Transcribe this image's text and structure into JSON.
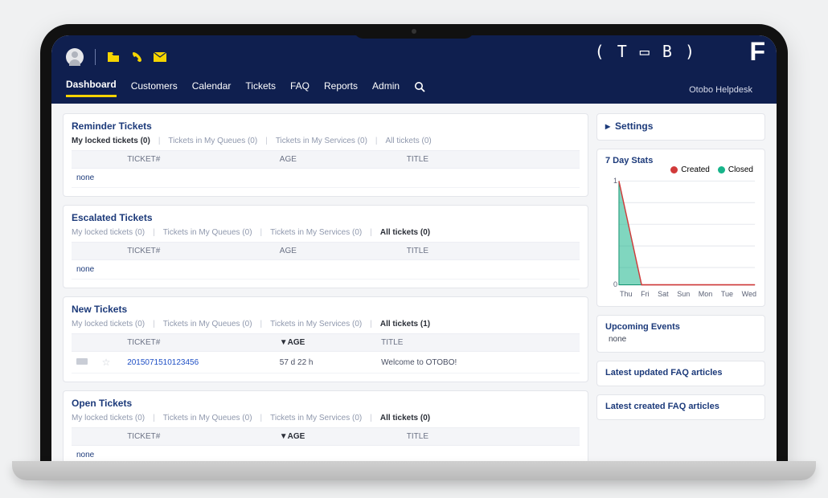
{
  "brand": {
    "logo_text": "( T ▭ B )",
    "f": "F",
    "name": "Otobo Helpdesk"
  },
  "nav": {
    "items": [
      "Dashboard",
      "Customers",
      "Calendar",
      "Tickets",
      "FAQ",
      "Reports",
      "Admin"
    ],
    "active": 0
  },
  "filters": {
    "my_locked_0": "My locked tickets (0)",
    "my_queues_0": "Tickets in My Queues (0)",
    "my_services_0": "Tickets in My Services (0)",
    "all_0": "All tickets (0)",
    "all_1": "All tickets (1)"
  },
  "cols": {
    "ticket": "TICKET#",
    "age": "AGE",
    "age_sorted": "▼AGE",
    "title": "TITLE"
  },
  "widgets": {
    "reminder": {
      "title": "Reminder Tickets",
      "empty": "none"
    },
    "escalated": {
      "title": "Escalated Tickets",
      "empty": "none"
    },
    "new": {
      "title": "New Tickets",
      "rows": [
        {
          "ticket": "2015071510123456",
          "age": "57 d 22 h",
          "title": "Welcome to OTOBO!"
        }
      ]
    },
    "open": {
      "title": "Open Tickets",
      "empty": "none"
    }
  },
  "sidebar": {
    "settings": "Settings",
    "stats_title": "7 Day Stats",
    "upcoming_title": "Upcoming Events",
    "upcoming_none": "none",
    "faq_updated": "Latest updated FAQ articles",
    "faq_created": "Latest created FAQ articles",
    "legend": {
      "created": "Created",
      "closed": "Closed"
    }
  },
  "chart_data": {
    "type": "area",
    "x": [
      "Thu",
      "Fri",
      "Sat",
      "Sun",
      "Mon",
      "Tue",
      "Wed"
    ],
    "series": [
      {
        "name": "Created",
        "color": "#d13a3a",
        "values": [
          1,
          0,
          0,
          0,
          0,
          0,
          0
        ]
      },
      {
        "name": "Closed",
        "color": "#17b48a",
        "values": [
          1,
          0,
          0,
          0,
          0,
          0,
          0
        ]
      }
    ],
    "title": "7 Day Stats",
    "xlabel": "",
    "ylabel": "",
    "ylim": [
      0,
      1
    ],
    "yticks": [
      0,
      1
    ]
  }
}
